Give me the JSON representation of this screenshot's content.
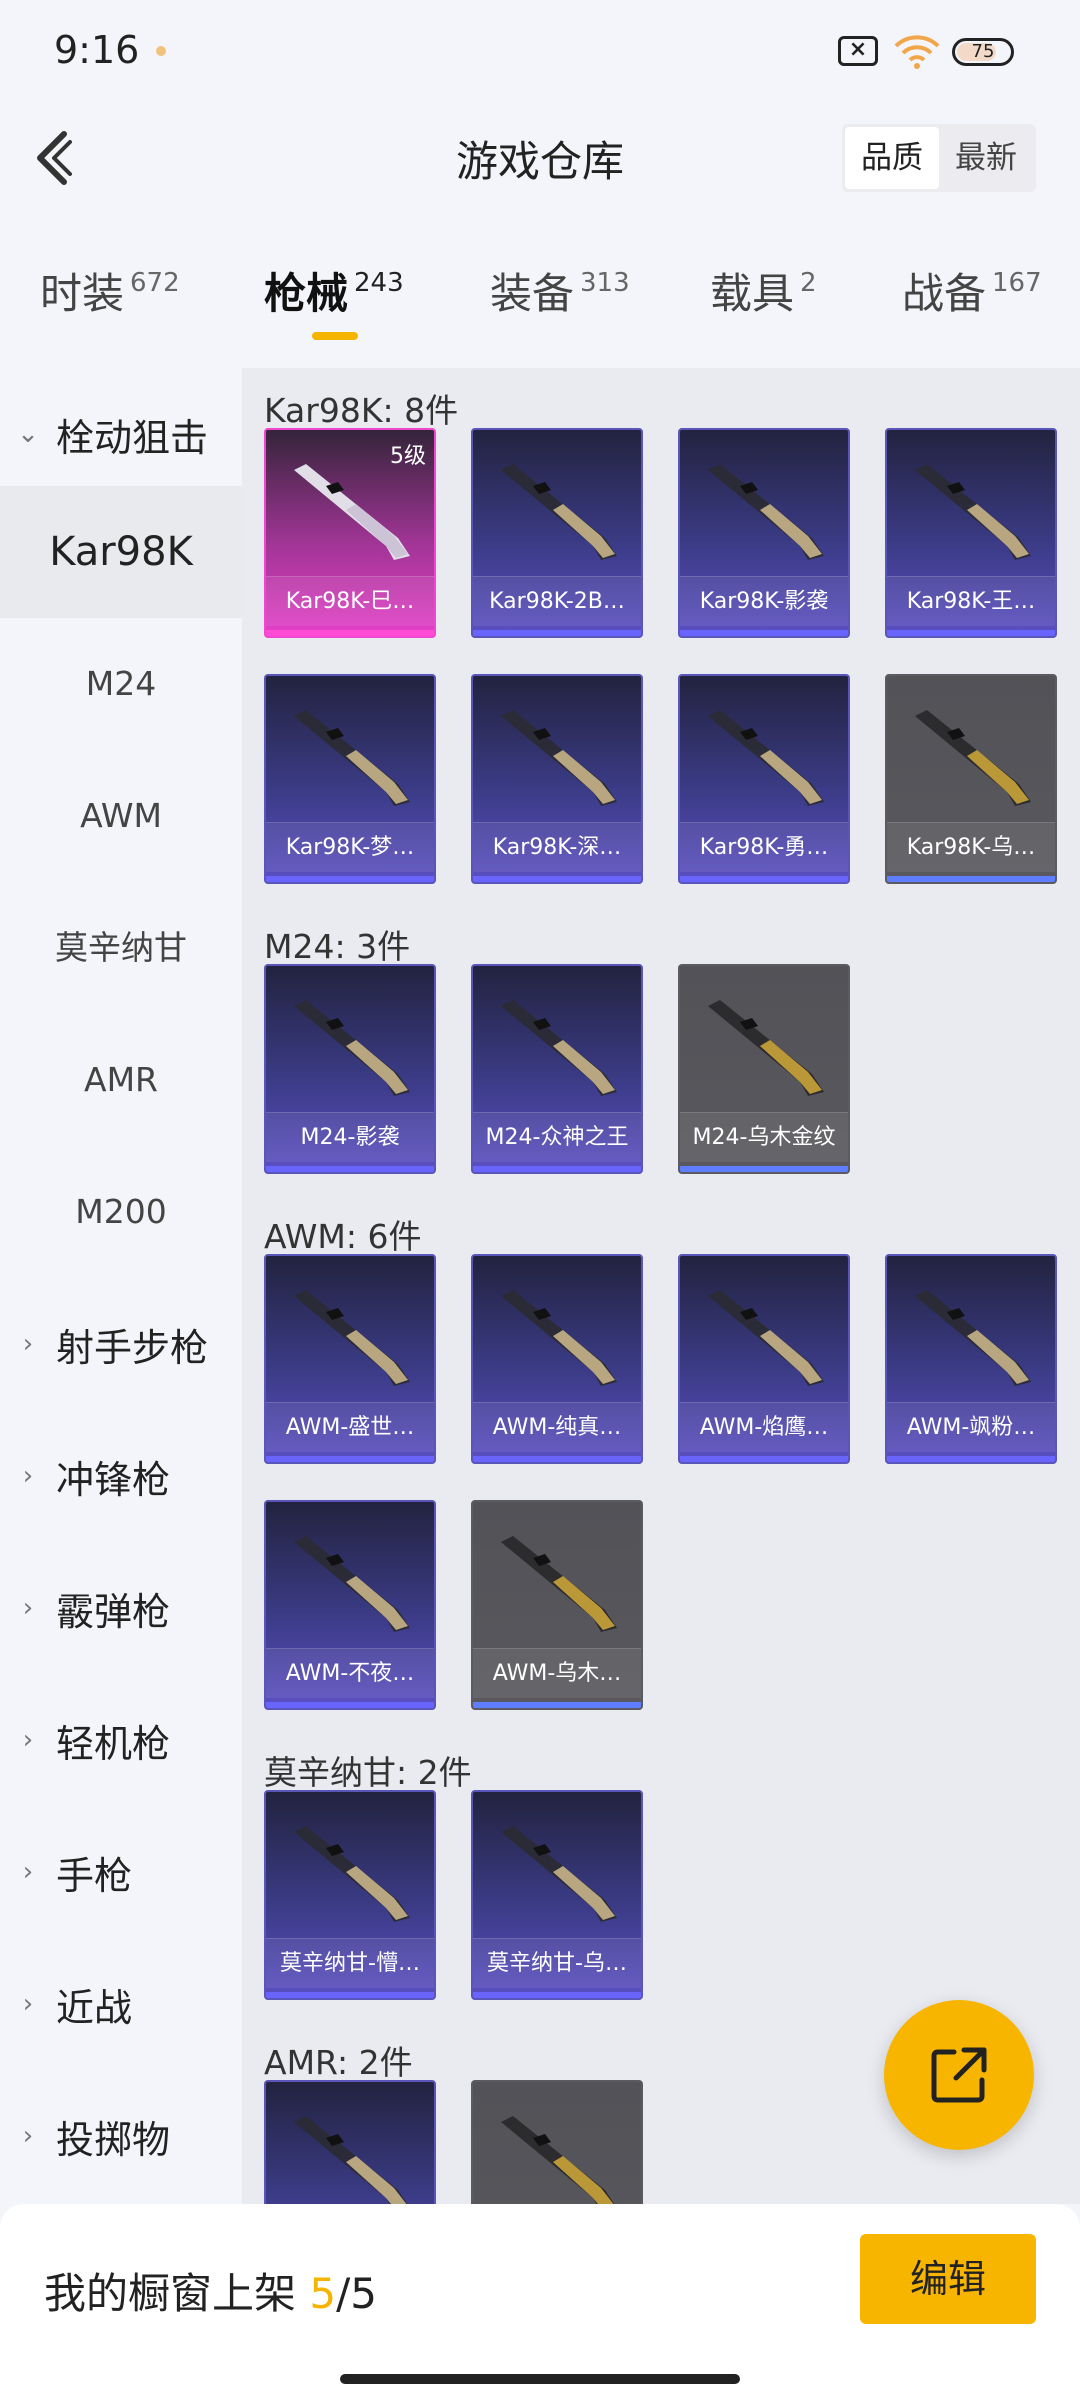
{
  "status": {
    "time": "9:16",
    "battery": "75"
  },
  "header": {
    "title": "游戏仓库",
    "sort_options": [
      "品质",
      "最新"
    ]
  },
  "tabs": [
    {
      "label": "时装",
      "count": "672"
    },
    {
      "label": "枪械",
      "count": "243"
    },
    {
      "label": "装备",
      "count": "313"
    },
    {
      "label": "载具",
      "count": "2"
    },
    {
      "label": "战备",
      "count": "167"
    }
  ],
  "sidebar": {
    "category_open": "栓动狙击",
    "subs": [
      "Kar98K",
      "M24",
      "AWM",
      "莫辛纳甘",
      "AMR",
      "M200"
    ],
    "categories": [
      "射手步枪",
      "冲锋枪",
      "霰弹枪",
      "轻机枪",
      "手枪",
      "近战",
      "投掷物"
    ]
  },
  "groups": [
    {
      "title": "Kar98K: 8件",
      "items": [
        {
          "name": "Kar98K-巳…",
          "level": "5级",
          "tier": "gold"
        },
        {
          "name": "Kar98K-2B…",
          "tier": "purple"
        },
        {
          "name": "Kar98K-影袭",
          "tier": "purple"
        },
        {
          "name": "Kar98K-王…",
          "tier": "purple"
        },
        {
          "name": "Kar98K-梦…",
          "tier": "purple"
        },
        {
          "name": "Kar98K-深…",
          "tier": "purple"
        },
        {
          "name": "Kar98K-勇…",
          "tier": "purple"
        },
        {
          "name": "Kar98K-乌…",
          "tier": "gray"
        }
      ]
    },
    {
      "title": "M24: 3件",
      "items": [
        {
          "name": "M24-影袭",
          "tier": "purple"
        },
        {
          "name": "M24-众神之王",
          "tier": "purple"
        },
        {
          "name": "M24-乌木金纹",
          "tier": "gray"
        }
      ]
    },
    {
      "title": "AWM: 6件",
      "items": [
        {
          "name": "AWM-盛世…",
          "tier": "purple"
        },
        {
          "name": "AWM-纯真…",
          "tier": "purple"
        },
        {
          "name": "AWM-焰鹰…",
          "tier": "purple"
        },
        {
          "name": "AWM-飒粉…",
          "tier": "purple"
        },
        {
          "name": "AWM-不夜…",
          "tier": "purple"
        },
        {
          "name": "AWM-乌木…",
          "tier": "gray"
        }
      ]
    },
    {
      "title": "莫辛纳甘: 2件",
      "items": [
        {
          "name": "莫辛纳甘-懵…",
          "tier": "purple"
        },
        {
          "name": "莫辛纳甘-乌…",
          "tier": "purple"
        }
      ]
    },
    {
      "title": "AMR: 2件",
      "items": [
        {
          "name": "",
          "tier": "purple"
        },
        {
          "name": "",
          "tier": "gray"
        }
      ]
    }
  ],
  "bottom": {
    "showcase_label": "我的橱窗上架",
    "showcase_current": "5",
    "showcase_total": "/5",
    "edit_label": "编辑"
  },
  "colors": {
    "accent": "#f5b400",
    "purple_card": "#3b3b86",
    "gold_card": "#e440c8",
    "gray_card": "#58585e"
  }
}
